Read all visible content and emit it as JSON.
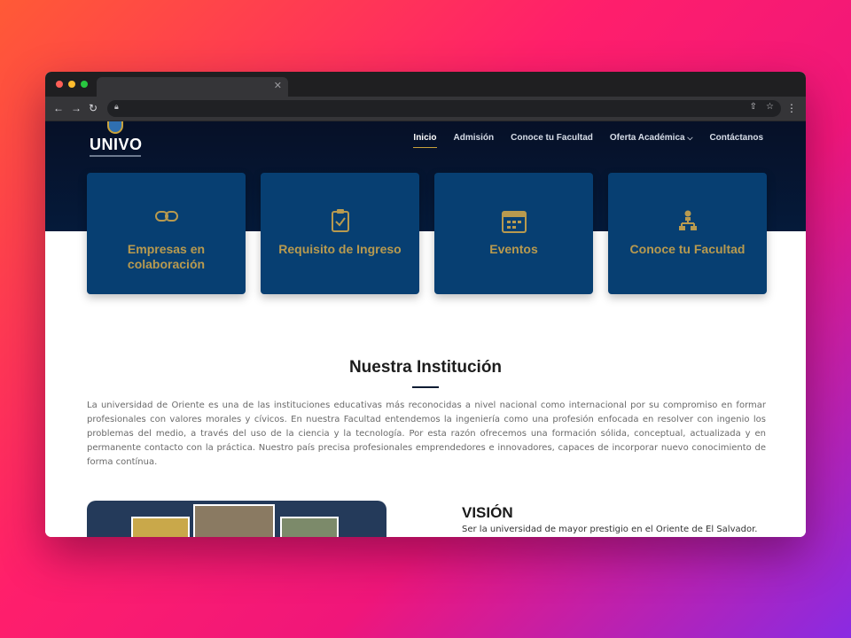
{
  "colors": {
    "hero_bg": "#061027",
    "card_bg": "#073f72",
    "card_text": "#b89a4f",
    "accent_gold": "#c9a23c"
  },
  "browser": {
    "tab_close_icon": "close-icon",
    "back_icon": "arrow-left-icon",
    "forward_icon": "arrow-right-icon",
    "reload_icon": "reload-icon",
    "lock_icon": "lock-icon",
    "share_icon": "share-icon",
    "bookmark_icon": "star-icon",
    "menu_icon": "kebab-menu-icon"
  },
  "site": {
    "logo_text": "UNIVO",
    "nav": [
      {
        "label": "Inicio",
        "active": true
      },
      {
        "label": "Admisión"
      },
      {
        "label": "Conoce tu Facultad"
      },
      {
        "label": "Oferta Académica",
        "dropdown": true
      },
      {
        "label": "Contáctanos"
      }
    ],
    "cards": [
      {
        "label": "Empresas en colaboración",
        "icon": "link-icon"
      },
      {
        "label": "Requisito de Ingreso",
        "icon": "clipboard-check-icon"
      },
      {
        "label": "Eventos",
        "icon": "calendar-icon"
      },
      {
        "label": "Conoce tu Facultad",
        "icon": "org-chart-icon"
      }
    ],
    "section_title": "Nuestra Institución",
    "intro_text": "La universidad de Oriente es una de las instituciones educativas más reconocidas a nivel nacional como internacional por su compromiso en formar profesionales con valores morales y cívicos. En nuestra Facultad entendemos la ingeniería como una profesión enfocada en resolver con ingenio los problemas del medio, a través del uso de la ciencia y la tecnología. Por esta razón ofrecemos una formación sólida, conceptual, actualizada y en permanente contacto con la práctica. Nuestro país precisa profesionales emprendedores e innovadores, capaces de incorporar nuevo conocimiento de forma contínua.",
    "vision_title": "VISIÓN",
    "vision_text": "Ser la universidad de mayor prestigio en el Oriente de El Salvador."
  }
}
